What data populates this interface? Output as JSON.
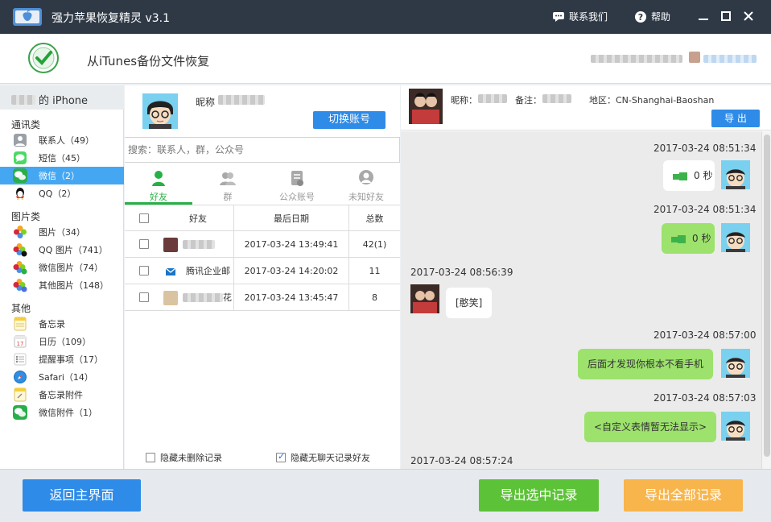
{
  "app": {
    "title": "强力苹果恢复精灵 v3.1",
    "contact_label": "联系我们",
    "help_label": "帮助"
  },
  "header": {
    "title": "从iTunes备份文件恢复"
  },
  "sidebar": {
    "device_label": "的 iPhone",
    "categories": {
      "comm": "通讯类",
      "pics": "图片类",
      "other": "其他"
    },
    "items": [
      {
        "label": "联系人（49）",
        "icon": "contacts-icon"
      },
      {
        "label": "短信（45）",
        "icon": "sms-icon"
      },
      {
        "label": "微信（2）",
        "icon": "wechat-icon",
        "active": true
      },
      {
        "label": "QQ（2）",
        "icon": "qq-icon"
      },
      {
        "label": "图片（34）",
        "icon": "photos-icon"
      },
      {
        "label": "QQ 图片（741）",
        "icon": "qq-photos-icon"
      },
      {
        "label": "微信图片（74）",
        "icon": "wechat-photos-icon"
      },
      {
        "label": "其他图片（148）",
        "icon": "other-photos-icon"
      },
      {
        "label": "备忘录",
        "icon": "notes-icon"
      },
      {
        "label": "日历（109）",
        "icon": "calendar-icon"
      },
      {
        "label": "提醒事项（17）",
        "icon": "reminders-icon"
      },
      {
        "label": "Safari（14）",
        "icon": "safari-icon"
      },
      {
        "label": "备忘录附件",
        "icon": "notes-attachment-icon"
      },
      {
        "label": "微信附件（1）",
        "icon": "wechat-attachment-icon"
      }
    ]
  },
  "account": {
    "nickname_label": "昵称",
    "switch_label": "切换账号"
  },
  "search": {
    "placeholder": "搜索：联系人，群，公众号"
  },
  "tabs": [
    {
      "label": "好友",
      "icon": "friend-icon",
      "active": true
    },
    {
      "label": "群",
      "icon": "group-icon"
    },
    {
      "label": "公众账号",
      "icon": "official-account-icon"
    },
    {
      "label": "未知好友",
      "icon": "unknown-friend-icon"
    }
  ],
  "grid": {
    "headers": {
      "friend": "好友",
      "last_date": "最后日期",
      "total": "总数"
    },
    "rows": [
      {
        "name": "",
        "date": "2017-03-24 13:49:41",
        "total": "42(1)"
      },
      {
        "name": "腾讯企业邮",
        "date": "2017-03-24 14:20:02",
        "total": "11"
      },
      {
        "name": "花",
        "date": "2017-03-24 13:45:47",
        "total": "8"
      }
    ]
  },
  "footer_options": {
    "hide_undeleted": "隐藏未删除记录",
    "hide_no_chat": "隐藏无聊天记录好友",
    "hide_undeleted_checked": false,
    "hide_no_chat_checked": true
  },
  "chat_header": {
    "nickname_label": "昵称：",
    "remark_label": "备注：",
    "region": "地区：CN-Shanghai-Baoshan",
    "export_label": "导 出"
  },
  "messages": [
    {
      "time": "2017-03-24 08:51:34",
      "text": "0 秒",
      "side": "me",
      "kind": "voice-white"
    },
    {
      "time": "2017-03-24 08:51:34",
      "text": "0 秒",
      "side": "me",
      "kind": "voice-green"
    },
    {
      "time": "2017-03-24 08:56:39",
      "text": "[憨笑]",
      "side": "other",
      "kind": "text"
    },
    {
      "time": "2017-03-24 08:57:00",
      "text": "后面才发现你根本不看手机",
      "side": "me",
      "kind": "text"
    },
    {
      "time": "2017-03-24 08:57:03",
      "text": "<自定义表情暂无法显示>",
      "side": "me",
      "kind": "text"
    },
    {
      "time": "2017-03-24 08:57:24",
      "text": "",
      "side": "other",
      "kind": "time-only"
    }
  ],
  "bottom": {
    "back_label": "返回主界面",
    "export_selected_label": "导出选中记录",
    "export_all_label": "导出全部记录"
  },
  "colors": {
    "titlebar": "#2f3946",
    "accent_blue": "#2e8be8",
    "wechat_green": "#28b046",
    "bubble_green": "#9ce26c",
    "export_selected": "#5cc237",
    "export_all": "#f8b54c",
    "sidebar_active": "#45a7f1"
  }
}
